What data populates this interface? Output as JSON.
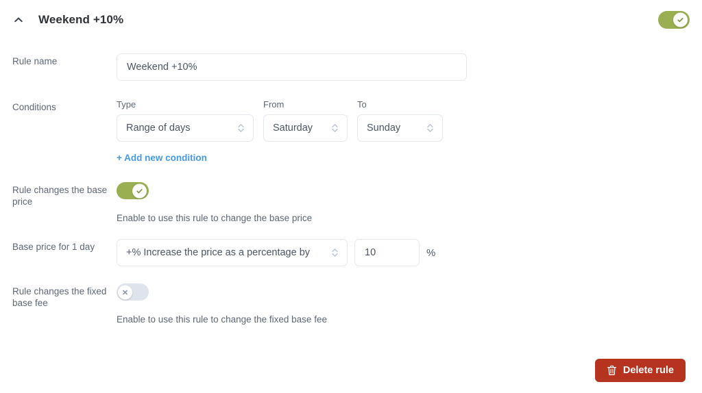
{
  "header": {
    "title": "Weekend +10%",
    "collapse_icon": "chevron-up-icon",
    "enabled": true
  },
  "rule_name": {
    "label": "Rule name",
    "value": "Weekend +10%",
    "placeholder": "Rule name"
  },
  "conditions": {
    "label": "Conditions",
    "fields": [
      {
        "caption": "Type",
        "value": "Range of days"
      },
      {
        "caption": "From",
        "value": "Saturday"
      },
      {
        "caption": "To",
        "value": "Sunday"
      }
    ],
    "add_link": "+ Add new condition"
  },
  "base_price_toggle": {
    "label": "Rule changes the base price",
    "enabled": true,
    "helper": "Enable to use this rule to change the base price"
  },
  "base_price": {
    "label": "Base price for 1 day",
    "change_type": "+% Increase the price as a percentage by",
    "amount": "10",
    "unit": "%"
  },
  "fixed_fee_toggle": {
    "label": "Rule changes the fixed base fee",
    "enabled": false,
    "helper": "Enable to use this rule to change the fixed base fee"
  },
  "actions": {
    "delete_label": "Delete rule",
    "delete_icon": "trash-icon"
  },
  "colors": {
    "toggle_on": "#9aaf52",
    "toggle_off": "#dfe3eb",
    "link": "#459ae6",
    "danger": "#b5331f",
    "border": "#e4e8ef",
    "label_text": "#5d6674"
  }
}
